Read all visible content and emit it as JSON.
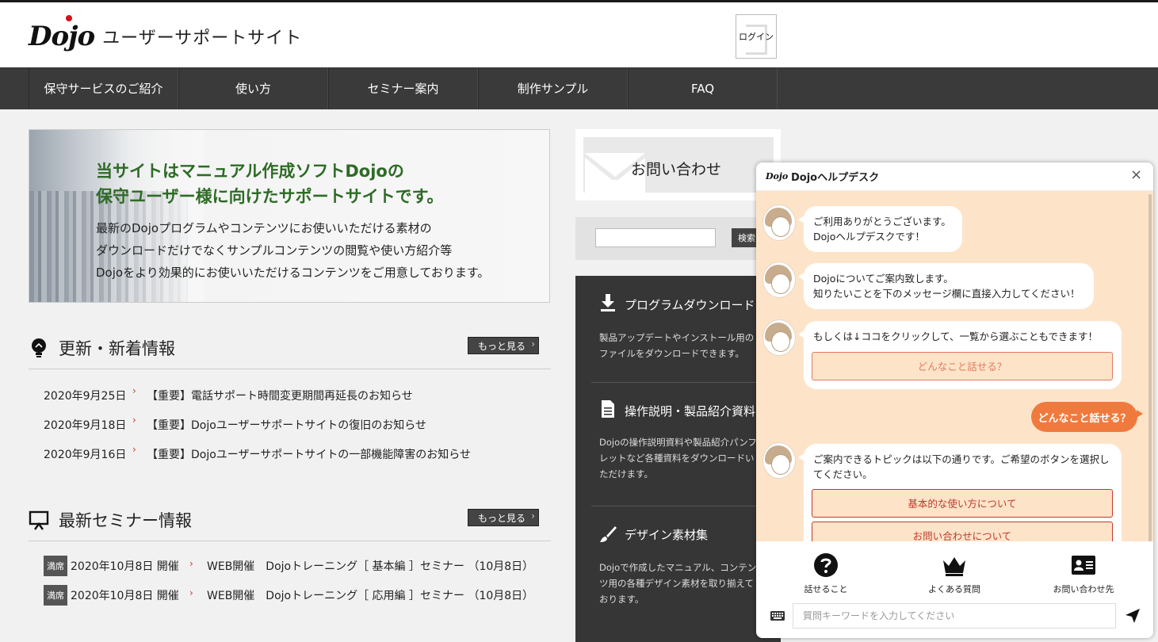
{
  "header": {
    "logo_text": "Dojo",
    "site_title": "ユーザーサポートサイト",
    "login_label": "ログイン"
  },
  "nav": {
    "items": [
      "保守サービスのご紹介",
      "使い方",
      "セミナー案内",
      "制作サンプル",
      "FAQ"
    ]
  },
  "banner": {
    "headline_1": "当サイトはマニュアル作成ソフトDojoの",
    "headline_2": "保守ユーザー様に向けたサポートサイトです。",
    "body_1": "最新のDojoプログラムやコンテンツにお使いいただける素材の",
    "body_2": "ダウンロードだけでなくサンプルコンテンツの閲覧や使い方紹介等",
    "body_3": "Dojoをより効果的にお使いいただけるコンテンツをご用意しております。"
  },
  "news": {
    "title": "更新・新着情報",
    "more_label": "もっと見る",
    "items": [
      {
        "date": "2020年9月25日",
        "text": "【重要】電話サポート時間変更期間再延長のお知らせ"
      },
      {
        "date": "2020年9月18日",
        "text": "【重要】Dojoユーザーサポートサイトの復旧のお知らせ"
      },
      {
        "date": "2020年9月16日",
        "text": "【重要】Dojoユーザーサポートサイトの一部機能障害のお知らせ"
      }
    ]
  },
  "seminar": {
    "title": "最新セミナー情報",
    "more_label": "もっと見る",
    "items": [
      {
        "badge": "満席",
        "date": "2020年10月8日 開催",
        "text": "WEB開催　Dojoトレーニング［ 基本編 ］セミナー （10月8日）"
      },
      {
        "badge": "満席",
        "date": "2020年10月8日 開催",
        "text": "WEB開催　Dojoトレーニング［ 応用編 ］セミナー （10月8日）"
      }
    ]
  },
  "sidebar": {
    "contact_label": "お問い合わせ",
    "search_button": "検索",
    "links": [
      {
        "title": "プログラムダウンロード",
        "desc": "製品アップデートやインストール用のファイルをダウンロードできます。",
        "icon": "download-icon"
      },
      {
        "title": "操作説明・製品紹介資料",
        "desc": "Dojoの操作説明資料や製品紹介パンフレットなど各種資料をダウンロードいただけます。",
        "icon": "document-icon"
      },
      {
        "title": "デザイン素材集",
        "desc": "Dojoで作成したマニュアル、コンテンツ用の各種デザイン素材を取り揃えております。",
        "icon": "brush-icon"
      }
    ]
  },
  "chat": {
    "header_logo": "Dojo",
    "title": "Dojoヘルプデスク",
    "close": "×",
    "msg1_l1": "ご利用ありがとうございます。",
    "msg1_l2": "Dojoヘルプデスクです！",
    "msg2_l1": "Dojoについてご案内致します。",
    "msg2_l2": "知りたいことを下のメッセージ欄に直接入力してください！",
    "msg3": "もしくは↓ココをクリックして、一覧から選ぶこともできます！",
    "msg3_choice": "どんなこと話せる？",
    "user_msg": "どんなこと話せる？",
    "msg4": "ご案内できるトピックは以下の通りです。ご希望のボタンを選択してください。",
    "choices": [
      "基本的な使い方について",
      "お問い合わせについて"
    ],
    "footer": [
      "話せること",
      "よくある質問",
      "お問い合わせ先"
    ],
    "input_placeholder": "質問キーワードを入力してください",
    "accent": "#f07a3e",
    "background": "#fde4c9"
  }
}
